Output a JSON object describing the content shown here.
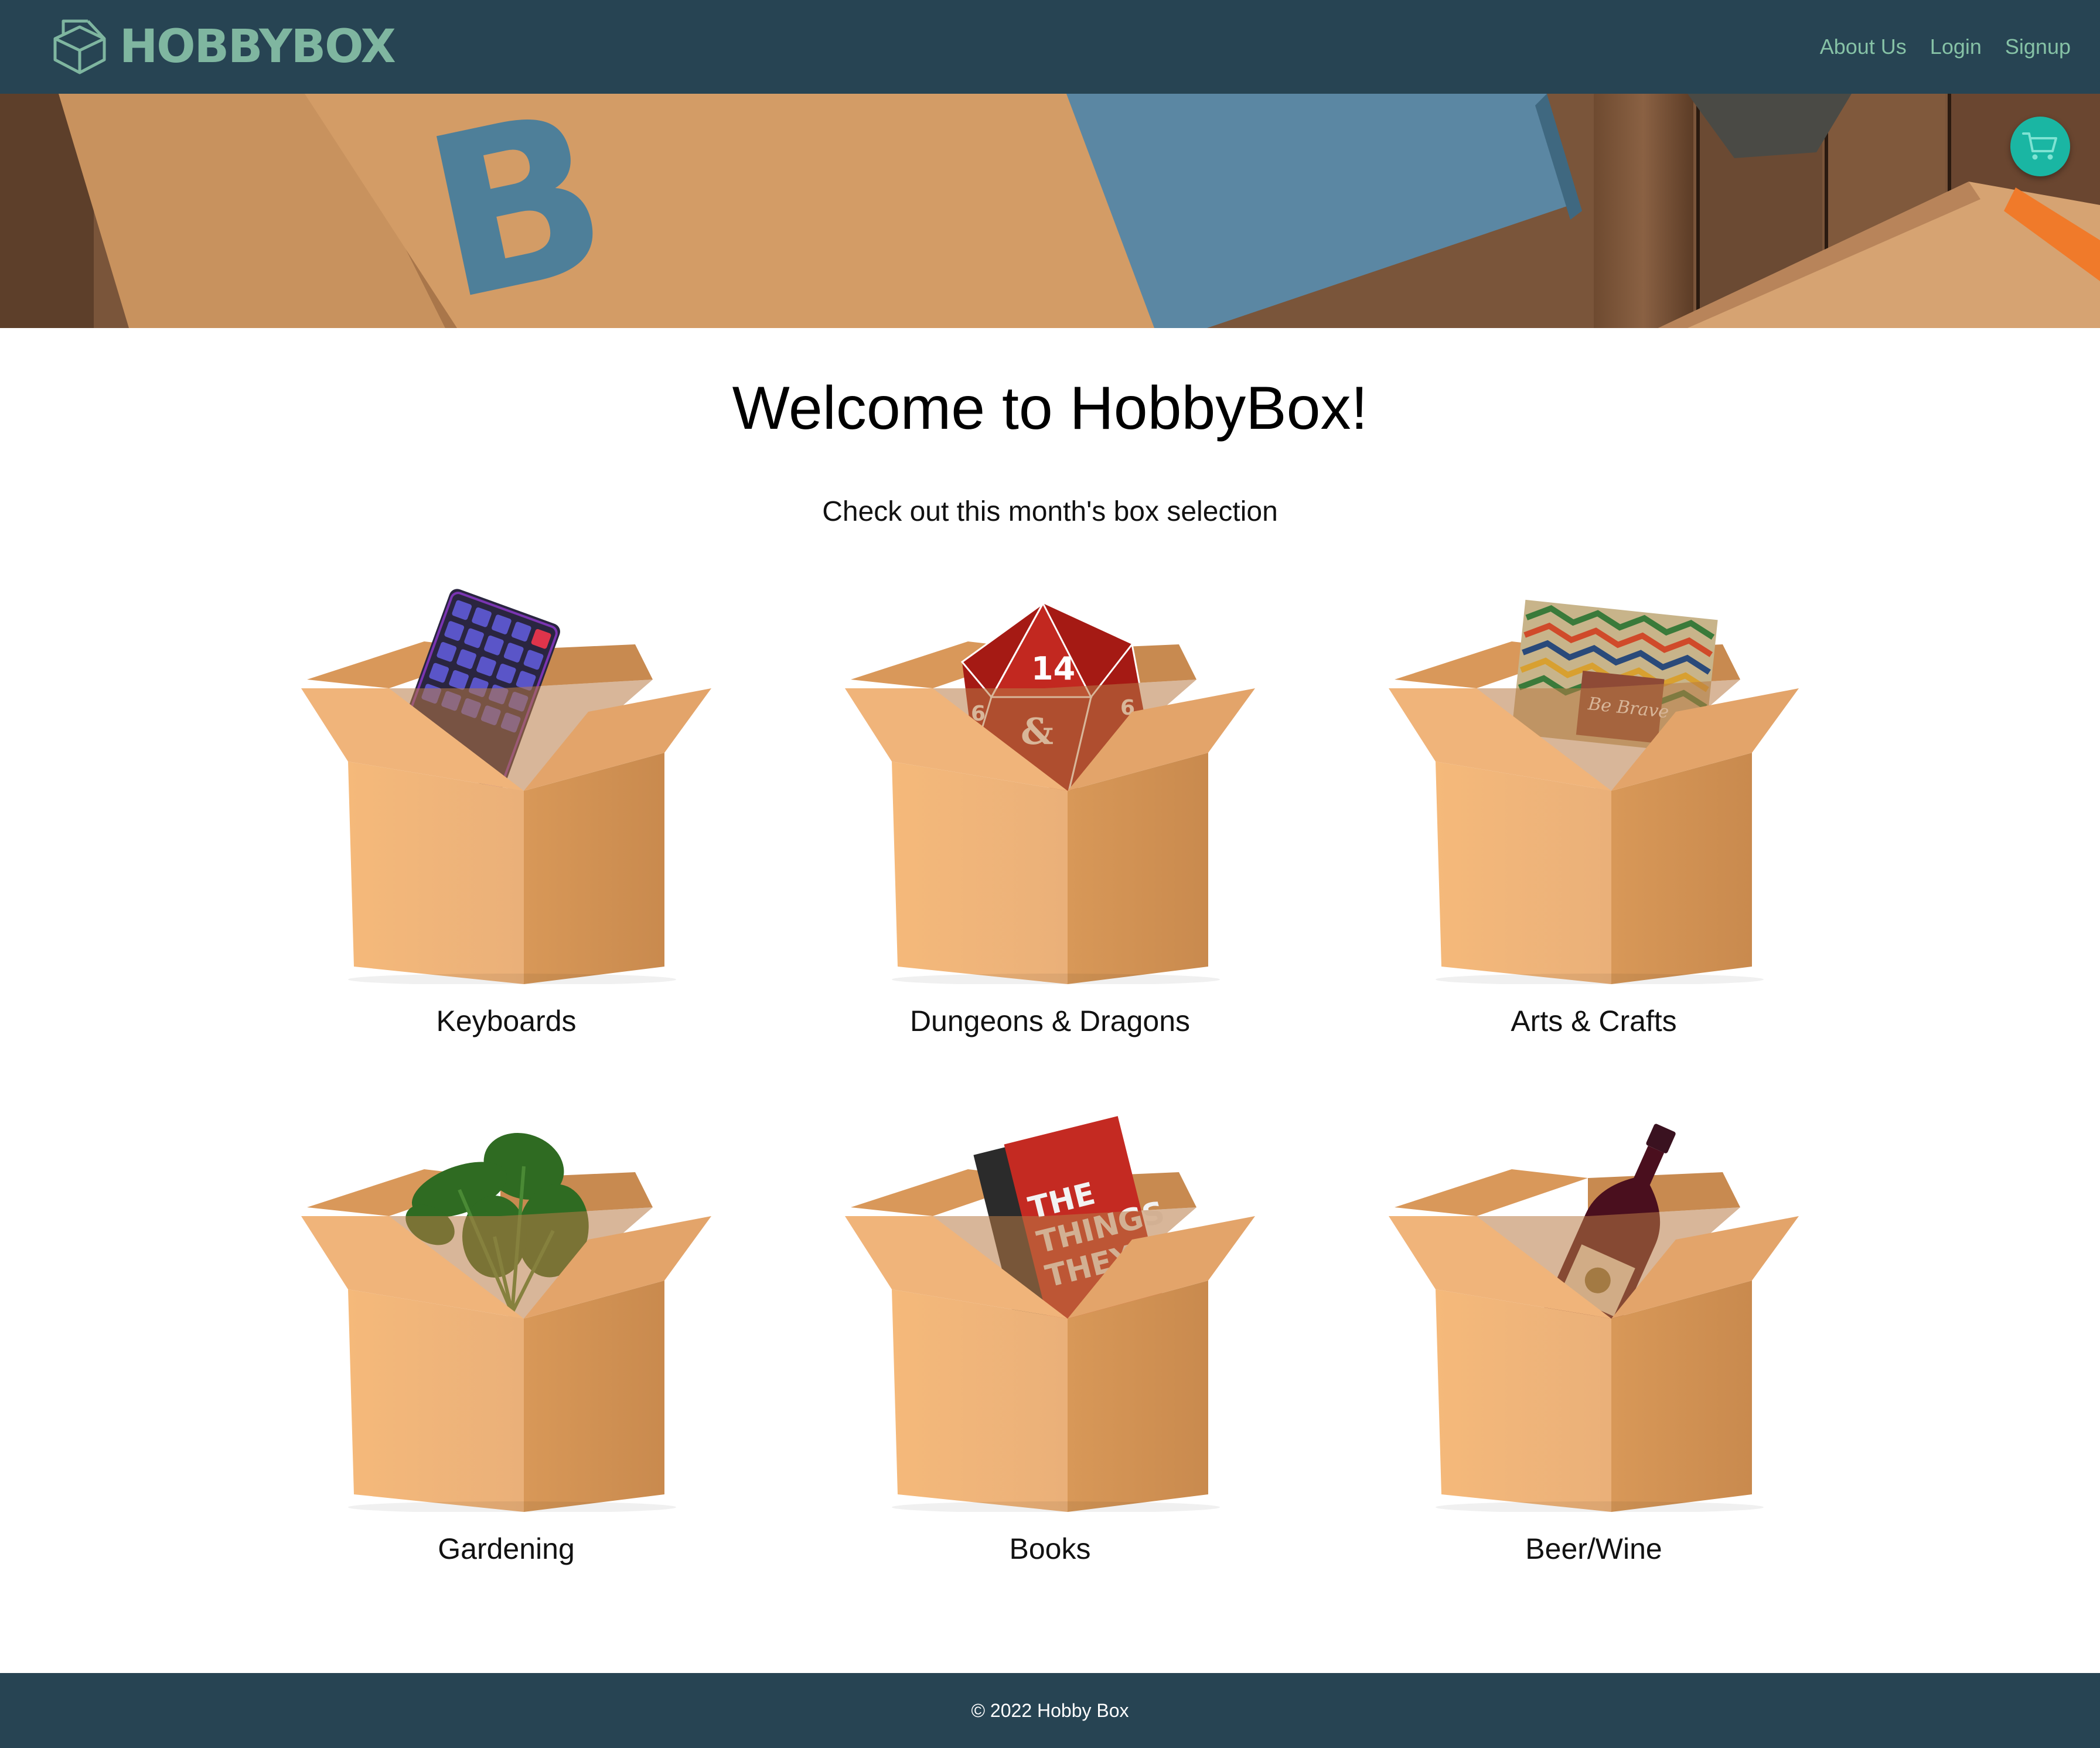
{
  "navbar": {
    "brand": "HOBBYBOX",
    "links": {
      "about": "About Us",
      "login": "Login",
      "signup": "Signup"
    }
  },
  "main": {
    "title": "Welcome to HobbyBox!",
    "subtitle": "Check out this month's box selection"
  },
  "boxes": [
    {
      "label": "Keyboards",
      "contents": "keyboard"
    },
    {
      "label": "Dungeons & Dragons",
      "contents": "d20-die"
    },
    {
      "label": "Arts & Crafts",
      "contents": "craft-kit"
    },
    {
      "label": "Gardening",
      "contents": "plant"
    },
    {
      "label": "Books",
      "contents": "book"
    },
    {
      "label": "Beer/Wine",
      "contents": "wine-bottle"
    }
  ],
  "footer": {
    "text": "© 2022 Hobby Box"
  },
  "colors": {
    "navbar_bg": "#274453",
    "brand_green": "#7fb6a0",
    "nav_link": "#86c2a6",
    "cart_teal": "#1ab6a3",
    "cardboard": "#f0b47a"
  },
  "icons": {
    "brand": "box-logo-icon",
    "cart": "shopping-cart-icon"
  }
}
